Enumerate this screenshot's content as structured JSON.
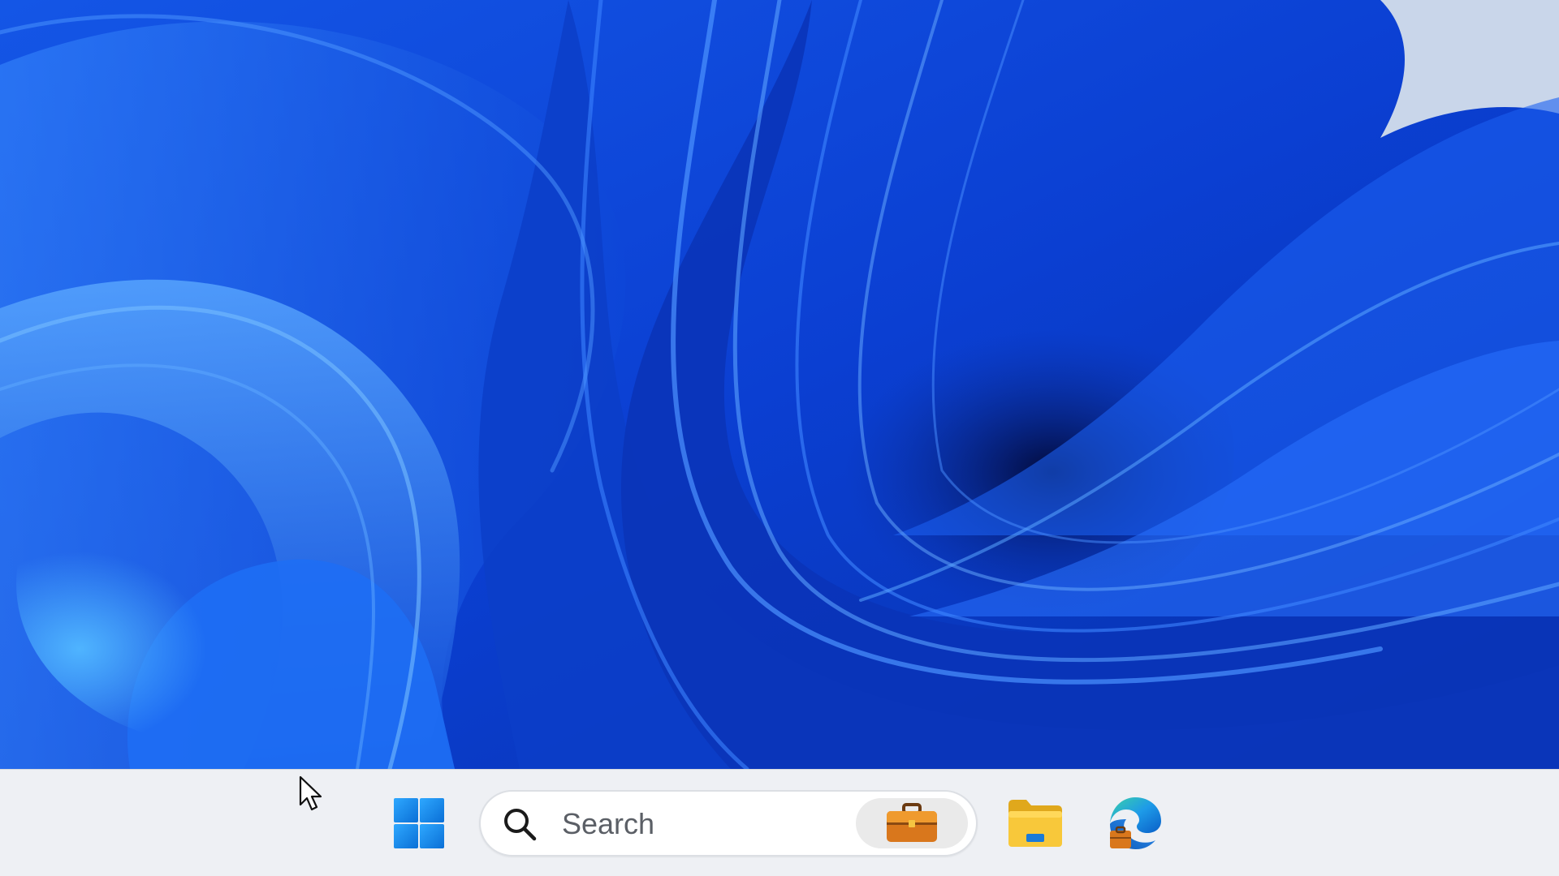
{
  "taskbar": {
    "search": {
      "placeholder": "Search",
      "highlight_icon": "briefcase-icon"
    },
    "items": [
      {
        "name": "start",
        "icon": "windows-logo-icon"
      },
      {
        "name": "file-explorer",
        "icon": "folder-icon"
      },
      {
        "name": "edge",
        "icon": "edge-browser-icon"
      }
    ]
  },
  "colors": {
    "wallpaper_base": "#0a3cc8",
    "taskbar_bg": "#eef0f4",
    "windows_blue": "#1a8cf0",
    "folder_yellow": "#f8c83a"
  }
}
